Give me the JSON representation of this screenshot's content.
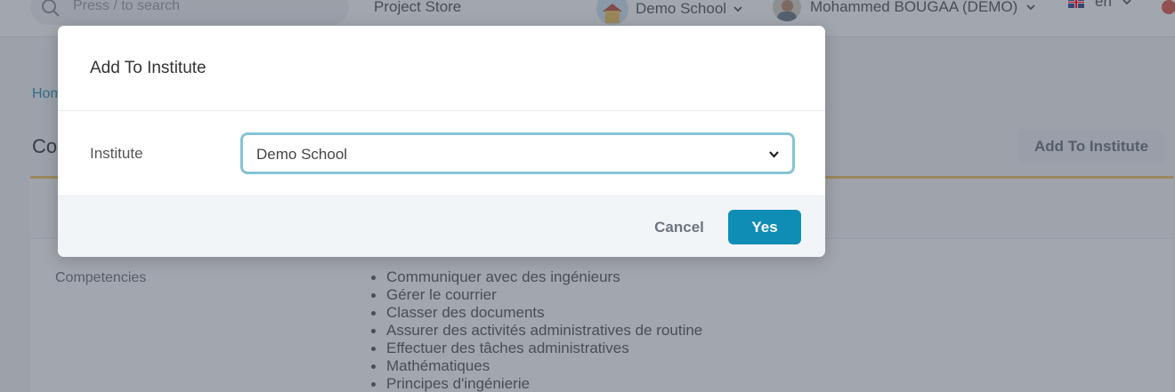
{
  "topbar": {
    "search_placeholder": "Press / to search",
    "project_store_label": "Project Store",
    "school_label": "Demo School",
    "user_label": "Mohammed BOUGAA (DEMO)",
    "language_label": "en"
  },
  "page": {
    "breadcrumb": "Hom",
    "title": "Co",
    "add_to_institute_label": "Add To Institute",
    "competencies_label": "Competencies",
    "competencies": [
      "Communiquer avec des ingénieurs",
      "Gérer le courrier",
      "Classer des documents",
      "Assurer des activités administratives de routine",
      "Effectuer des tâches administratives",
      "Mathématiques",
      "Principes d'ingénierie"
    ]
  },
  "modal": {
    "title": "Add To Institute",
    "institute_label": "Institute",
    "institute_value": "Demo School",
    "cancel_label": "Cancel",
    "yes_label": "Yes"
  },
  "colors": {
    "primary": "#0f8db5",
    "focus_border": "#86c3d5",
    "card_accent": "#f0c862"
  },
  "icons": [
    "search-icon",
    "chevron-down-icon",
    "flag-uk-icon",
    "notification-icon"
  ]
}
